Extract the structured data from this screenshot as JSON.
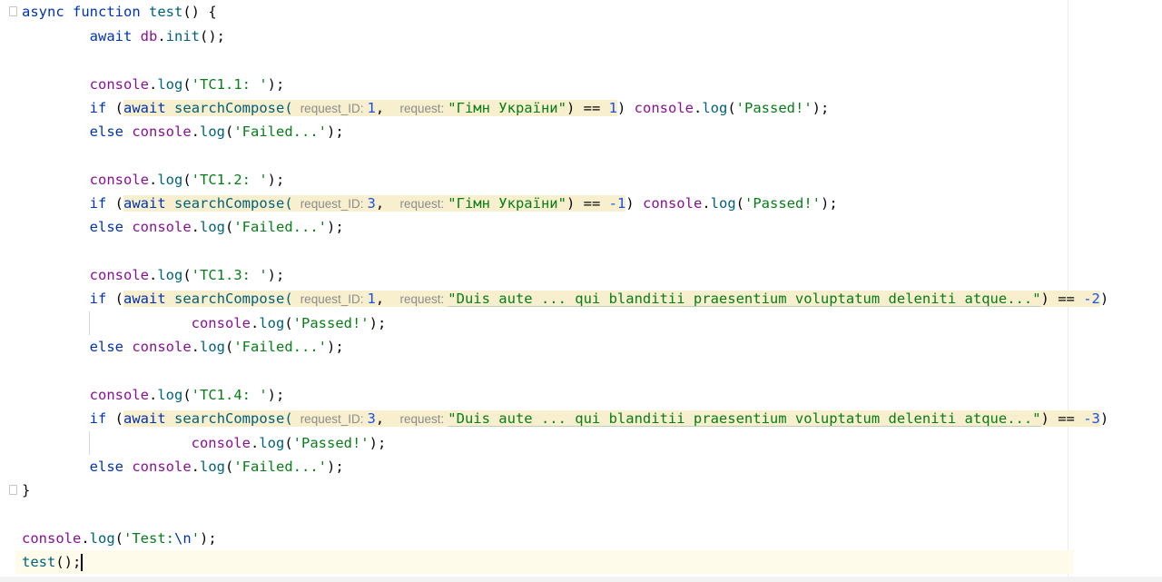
{
  "code": {
    "kw_async": "async",
    "kw_function": "function",
    "fn_test": "test",
    "open_paren_brace": "() {",
    "kw_await": "await",
    "db": "db",
    "dot": ".",
    "init": "init",
    "call_end": "();",
    "console": "console",
    "log": "log",
    "kw_if": "if",
    "kw_else": "else",
    "open_paren": "(",
    "searchCompose": "searchCompose(",
    "hint_request_id": "request_ID:",
    "hint_request": "request:",
    "comma": ",",
    "log_open": "(",
    "log_close": ");",
    "passed": "'Passed!'",
    "failed": "'Failed...'",
    "eqeq": ") == ",
    "close_paren": ")",
    "close_brace": "}",
    "tc": [
      {
        "label": "'TC1.1: '",
        "request_id": "1",
        "request": "\"Гімн України\"",
        "expected": "1",
        "neg": false
      },
      {
        "label": "'TC1.2: '",
        "request_id": "3",
        "request": "\"Гімн України\"",
        "expected": "-1",
        "neg": true
      },
      {
        "label": "'TC1.3: '",
        "request_id": "1",
        "request": "\"Duis aute ... qui blanditii praesentium voluptatum deleniti atque...\"",
        "expected": "-2",
        "neg": true
      },
      {
        "label": "'TC1.4: '",
        "request_id": "3",
        "request": "\"Duis aute ... qui blanditii praesentium voluptatum deleniti atque...\"",
        "expected": "-3",
        "neg": true
      }
    ],
    "test_label_open": "'Test:",
    "test_label_esc": "\\n",
    "test_label_close": "'",
    "test_call": "test",
    "test_call_end": "();"
  }
}
